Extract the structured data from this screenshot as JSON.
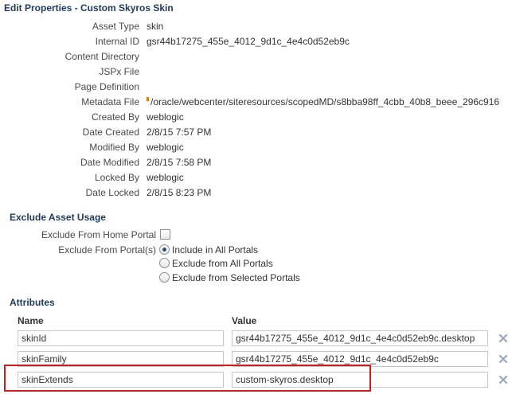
{
  "page": {
    "title": "Edit Properties - Custom Skyros Skin"
  },
  "properties": [
    {
      "label": "Asset Type",
      "value": "skin"
    },
    {
      "label": "Internal ID",
      "value": "gsr44b17275_455e_4012_9d1c_4e4c0d52eb9c"
    },
    {
      "label": "Content Directory",
      "value": ""
    },
    {
      "label": "JSPx File",
      "value": ""
    },
    {
      "label": "Page Definition",
      "value": ""
    },
    {
      "label": "Metadata File",
      "value": "/oracle/webcenter/siteresources/scopedMD/s8bba98ff_4cbb_40b8_beee_296c916"
    },
    {
      "label": "Created By",
      "value": "weblogic"
    },
    {
      "label": "Date Created",
      "value": "2/8/15 7:57 PM"
    },
    {
      "label": "Modified By",
      "value": "weblogic"
    },
    {
      "label": "Date Modified",
      "value": "2/8/15 7:58 PM"
    },
    {
      "label": "Locked By",
      "value": "weblogic"
    },
    {
      "label": "Date Locked",
      "value": "2/8/15 8:23 PM"
    }
  ],
  "exclude": {
    "title": "Exclude Asset Usage",
    "home_portal_label": "Exclude From Home Portal",
    "home_portal_checked": false,
    "portals_label": "Exclude From Portal(s)",
    "options": [
      {
        "label": "Include in All Portals",
        "checked": true
      },
      {
        "label": "Exclude from All Portals",
        "checked": false
      },
      {
        "label": "Exclude from Selected Portals",
        "checked": false
      }
    ]
  },
  "attributes": {
    "title": "Attributes",
    "columns": {
      "name": "Name",
      "value": "Value"
    },
    "rows": [
      {
        "name": "skinId",
        "value": "gsr44b17275_455e_4012_9d1c_4e4c0d52eb9c.desktop"
      },
      {
        "name": "skinFamily",
        "value": "gsr44b17275_455e_4012_9d1c_4e4c0d52eb9c"
      },
      {
        "name": "skinExtends",
        "value": "custom-skyros.desktop"
      }
    ]
  },
  "icons": {
    "delete": "delete-x-icon",
    "metadata_marker": "modified-marker-icon"
  },
  "colors": {
    "section_title": "#1f3a5a",
    "highlight": "#d11a1a",
    "marker": "#e07b1a",
    "delete_icon": "#9aa8b8"
  }
}
